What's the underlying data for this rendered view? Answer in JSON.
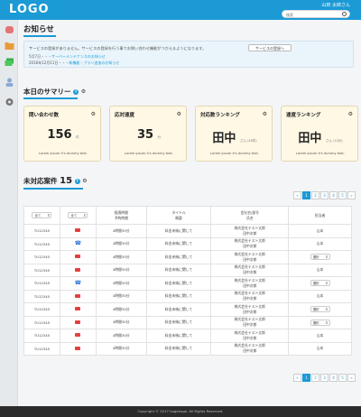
{
  "header": {
    "logo": "LOGO",
    "user": "山田 太郎さん",
    "search_placeholder": "検索"
  },
  "page": {
    "title": "お知らせ"
  },
  "notice": {
    "text": "サービスの登録がありません。サービスの登録を行う事でお問い合わせ機能がつかえるようになります。",
    "button": "サービスの登録へ",
    "items": [
      {
        "date": "5月7日・・・",
        "link": "サーバーメンテナンスのお知らせ"
      },
      {
        "date": "2016年12月11日・・・",
        "link": "新機能・プラン追加のお知らせ"
      }
    ]
  },
  "summary": {
    "title": "本日のサマリー",
    "help_icon": "?",
    "cards": [
      {
        "title": "問い合わせ数",
        "value": "156",
        "unit": "件",
        "footer": "Lorem ipsum it's dummy text."
      },
      {
        "title": "応対速度",
        "value": "35",
        "unit": "分",
        "footer": "Lorem ipsum it's dummy text."
      },
      {
        "title": "対応数ランキング",
        "value": "田中",
        "unit": "さん (40件)",
        "footer": "Lorem ipsum it's dummy text."
      },
      {
        "title": "速度ランキング",
        "value": "田中",
        "unit": "さん (12分)",
        "footer": "Lorem ipsum it's dummy text."
      }
    ]
  },
  "cases": {
    "title": "未対応案件",
    "count": "15",
    "pager": [
      "«",
      "1",
      "2",
      "3",
      "4",
      "5",
      "»"
    ],
    "filters": [
      "全て",
      "全て"
    ],
    "headers": [
      "経過時間\n予約時間",
      "タイトル\n概要",
      "会社名/部号\n氏名",
      "担当者"
    ],
    "rows": [
      {
        "id": "TU12345",
        "channel": "mail",
        "time": "4時間30分",
        "title": "料金未納に関して",
        "company": "株式会社テスト太郎",
        "name": "田中次郎",
        "assignee": "山本"
      },
      {
        "id": "TU12345",
        "channel": "tel",
        "time": "4時間30分",
        "title": "料金未納に関して",
        "company": "株式会社テスト太郎",
        "name": "田中次郎",
        "assignee": "山本"
      },
      {
        "id": "TU12345",
        "channel": "mail",
        "time": "4時間30分",
        "title": "料金未納に関して",
        "company": "株式会社テスト太郎",
        "name": "田中次郎",
        "assignee": "選択"
      },
      {
        "id": "TU12345",
        "channel": "mail",
        "time": "4時間30分",
        "title": "料金未納に関して",
        "company": "株式会社テスト太郎",
        "name": "田中次郎",
        "assignee": "山本"
      },
      {
        "id": "TU12345",
        "channel": "tel",
        "time": "4時間30分",
        "title": "料金未納に関して",
        "company": "株式会社テスト太郎",
        "name": "田中次郎",
        "assignee": "選択"
      },
      {
        "id": "TU12345",
        "channel": "mail",
        "time": "4時間30分",
        "title": "料金未納に関して",
        "company": "株式会社テスト太郎",
        "name": "田中次郎",
        "assignee": "山本"
      },
      {
        "id": "TU12345",
        "channel": "mail",
        "time": "4時間30分",
        "title": "料金未納に関して",
        "company": "株式会社テスト太郎",
        "name": "田中次郎",
        "assignee": "選択"
      },
      {
        "id": "TU12345",
        "channel": "mail",
        "time": "4時間30分",
        "title": "料金未納に関して",
        "company": "株式会社テスト太郎",
        "name": "田中次郎",
        "assignee": "選択"
      },
      {
        "id": "TU12345",
        "channel": "mail",
        "time": "4時間30分",
        "title": "料金未納に関して",
        "company": "株式会社テスト太郎",
        "name": "田中次郎",
        "assignee": "山本"
      },
      {
        "id": "TU12345",
        "channel": "mail",
        "time": "4時間30分",
        "title": "料金未納に関して",
        "company": "株式会社テスト太郎",
        "name": "田中次郎",
        "assignee": "山本"
      }
    ]
  },
  "footer": {
    "text": "Copyright © 2017 hogehoge. All Rights Reserved."
  },
  "sidebar": {
    "icons": [
      "home-icon",
      "folder-icon",
      "chat-icon",
      "user-icon",
      "gear-icon"
    ]
  },
  "colors": {
    "accent": "#1b9ad6",
    "card_bg": "#fff8e5",
    "mail": "#e24040"
  }
}
